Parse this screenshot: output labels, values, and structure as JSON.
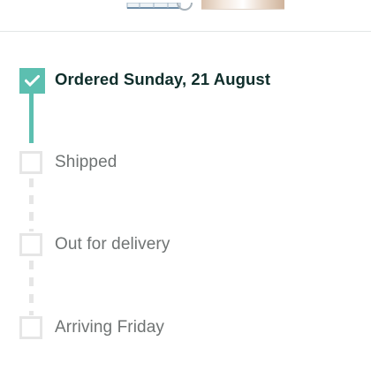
{
  "tracker": {
    "steps": [
      {
        "label": "Ordered Sunday, 21 August",
        "status": "complete"
      },
      {
        "label": "Shipped",
        "status": "pending"
      },
      {
        "label": "Out for delivery",
        "status": "pending"
      },
      {
        "label": "Arriving Friday",
        "status": "pending"
      }
    ]
  },
  "colors": {
    "accent": "#5cbfb0",
    "pending": "#e6e6e6",
    "label_done": "#0f2e2b",
    "label_pending": "#6f7373"
  },
  "icons": {
    "complete": "checkmark-icon"
  }
}
